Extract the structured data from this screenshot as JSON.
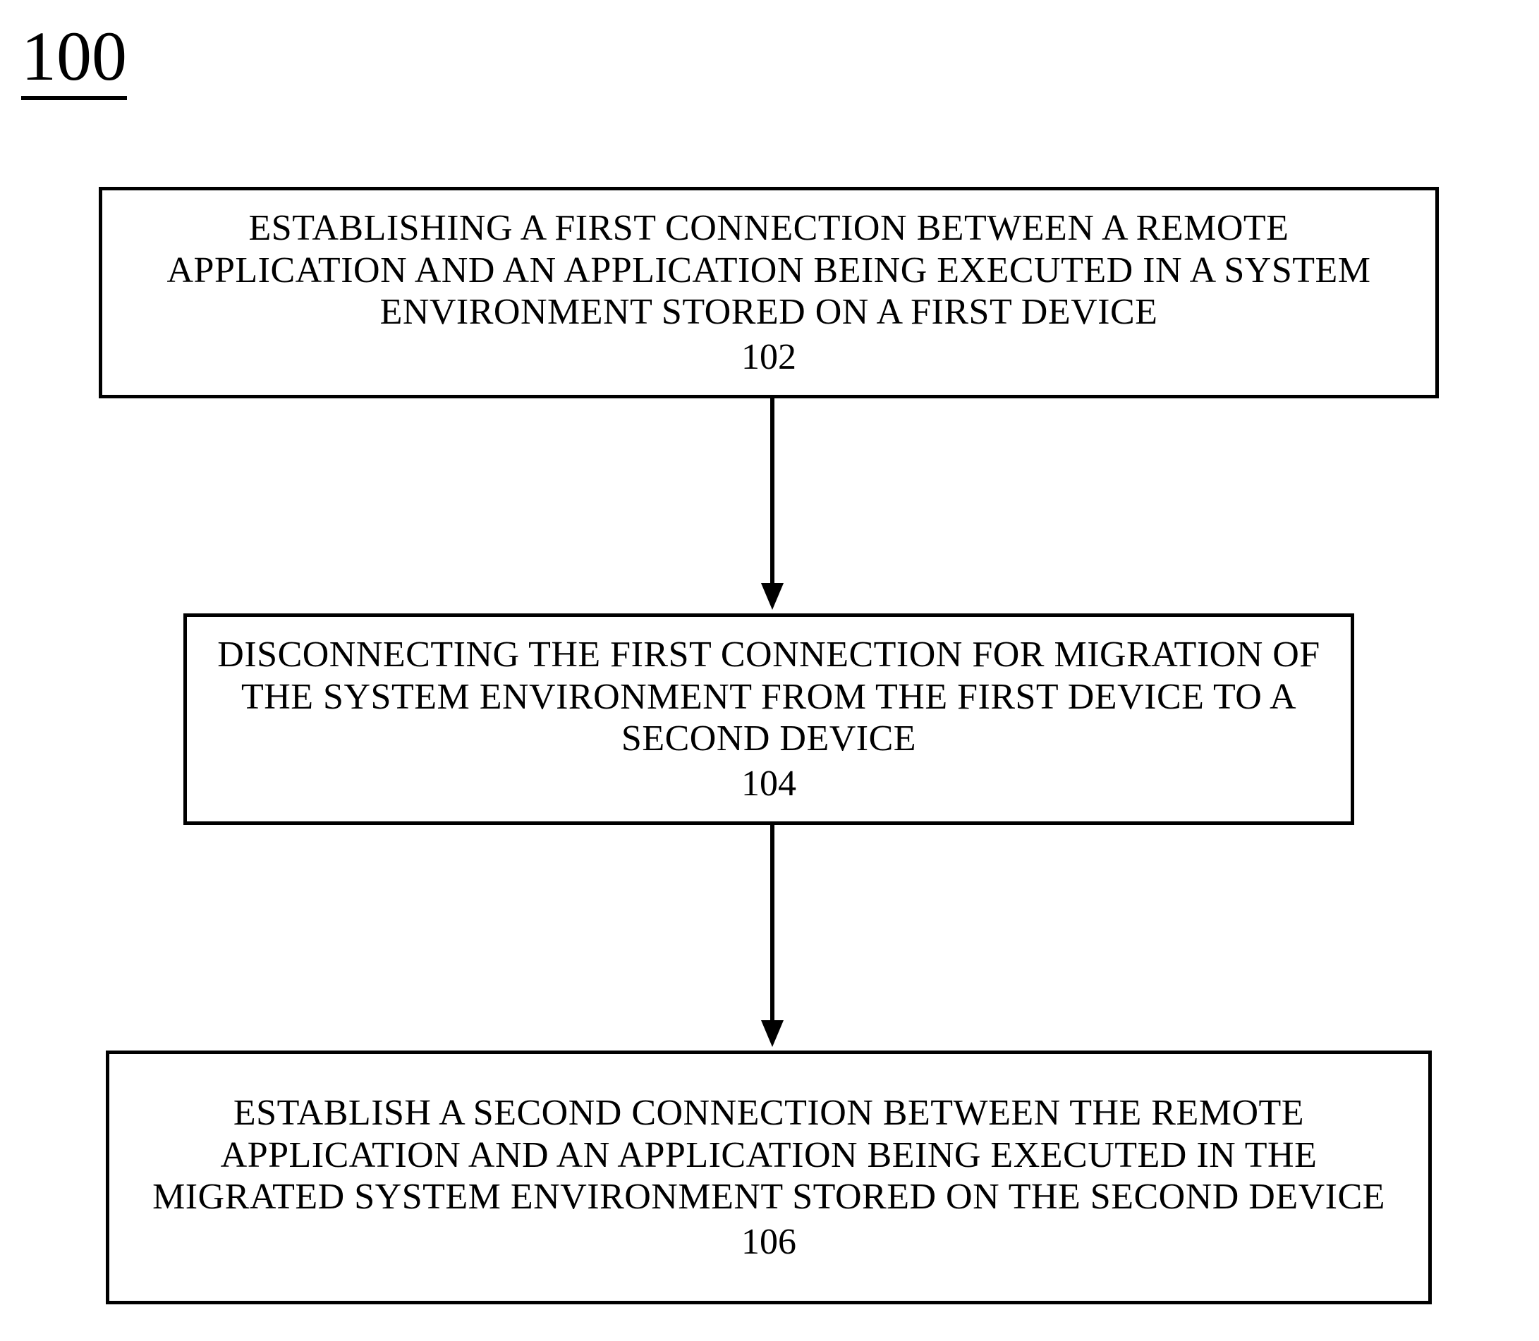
{
  "figure_number": "100",
  "steps": {
    "s1": {
      "text": "ESTABLISHING A FIRST CONNECTION BETWEEN A REMOTE APPLICATION AND AN APPLICATION BEING EXECUTED IN A SYSTEM ENVIRONMENT STORED ON A FIRST DEVICE",
      "ref": "102"
    },
    "s2": {
      "text": "DISCONNECTING THE FIRST CONNECTION FOR MIGRATION OF THE SYSTEM ENVIRONMENT FROM THE FIRST DEVICE TO A SECOND DEVICE",
      "ref": "104"
    },
    "s3": {
      "text": "ESTABLISH A SECOND CONNECTION BETWEEN THE REMOTE APPLICATION AND AN APPLICATION BEING EXECUTED IN THE MIGRATED SYSTEM ENVIRONMENT STORED ON THE SECOND DEVICE",
      "ref": "106"
    }
  }
}
